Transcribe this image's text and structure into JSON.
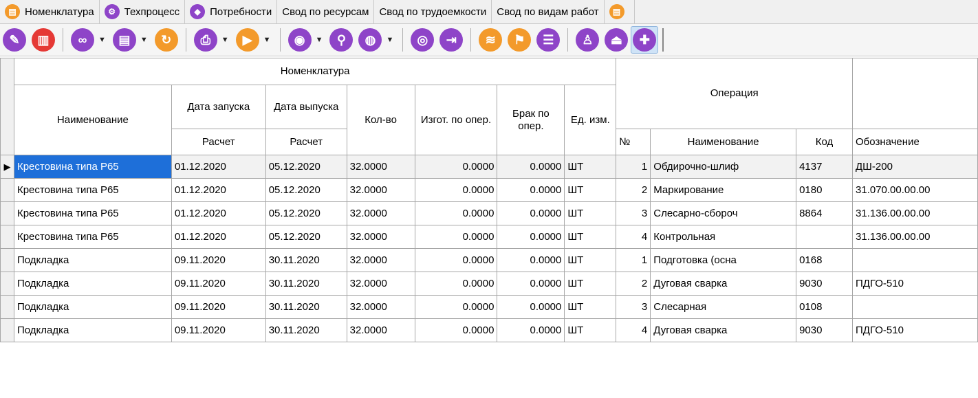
{
  "tabs": [
    {
      "label": "Номенклатура",
      "icon": "orange-book-icon"
    },
    {
      "label": "Техпроцесс",
      "icon": "purple-cog-icon"
    },
    {
      "label": "Потребности",
      "icon": "purple-tag-icon"
    },
    {
      "label": "Свод по ресурсам"
    },
    {
      "label": "Свод по трудоемкости"
    },
    {
      "label": "Свод по видам работ"
    }
  ],
  "toolbar": {
    "buttons": [
      "edit-icon",
      "delete-icon",
      "link-icon",
      "document-icon",
      "refresh-icon",
      "print-icon",
      "play-icon",
      "view-icon",
      "zoom-icon",
      "globe-icon",
      "disk-icon",
      "export-icon",
      "layers-icon",
      "flag-icon",
      "list-icon",
      "person-icon",
      "stamp-icon",
      "add-icon"
    ]
  },
  "grid": {
    "headers": {
      "group_nomenclature": "Номенклатура",
      "group_operation": "Операция",
      "name": "Наименование",
      "start_date": "Дата запуска",
      "release_date": "Дата выпуска",
      "calc1": "Расчет",
      "calc2": "Расчет",
      "qty": "Кол-во",
      "made": "Изгот. по опер.",
      "defect": "Брак по опер.",
      "unit": "Ед. изм.",
      "op_no": "№",
      "op_name": "Наименование",
      "op_code": "Код",
      "op_designation": "Обозначение"
    },
    "rows": [
      {
        "name": "Крестовина типа Р65",
        "start": "01.12.2020",
        "release": "05.12.2020",
        "qty": "32.0000",
        "made": "0.0000",
        "defect": "0.0000",
        "unit": "ШТ",
        "no": "1",
        "op": "Обдирочно-шлиф",
        "code": "4137",
        "des": "ДШ-200"
      },
      {
        "name": "Крестовина типа Р65",
        "start": "01.12.2020",
        "release": "05.12.2020",
        "qty": "32.0000",
        "made": "0.0000",
        "defect": "0.0000",
        "unit": "ШТ",
        "no": "2",
        "op": "Маркирование",
        "code": "0180",
        "des": "31.070.00.00.00"
      },
      {
        "name": "Крестовина типа Р65",
        "start": "01.12.2020",
        "release": "05.12.2020",
        "qty": "32.0000",
        "made": "0.0000",
        "defect": "0.0000",
        "unit": "ШТ",
        "no": "3",
        "op": "Слесарно-сбороч",
        "code": "8864",
        "des": "31.136.00.00.00"
      },
      {
        "name": "Крестовина типа Р65",
        "start": "01.12.2020",
        "release": "05.12.2020",
        "qty": "32.0000",
        "made": "0.0000",
        "defect": "0.0000",
        "unit": "ШТ",
        "no": "4",
        "op": "Контрольная",
        "code": "",
        "des": "31.136.00.00.00"
      },
      {
        "name": "Подкладка",
        "start": "09.11.2020",
        "release": "30.11.2020",
        "qty": "32.0000",
        "made": "0.0000",
        "defect": "0.0000",
        "unit": "ШТ",
        "no": "1",
        "op": "Подготовка (осна",
        "code": "0168",
        "des": ""
      },
      {
        "name": "Подкладка",
        "start": "09.11.2020",
        "release": "30.11.2020",
        "qty": "32.0000",
        "made": "0.0000",
        "defect": "0.0000",
        "unit": "ШТ",
        "no": "2",
        "op": "Дуговая сварка",
        "code": "9030",
        "des": "ПДГО-510"
      },
      {
        "name": "Подкладка",
        "start": "09.11.2020",
        "release": "30.11.2020",
        "qty": "32.0000",
        "made": "0.0000",
        "defect": "0.0000",
        "unit": "ШТ",
        "no": "3",
        "op": "Слесарная",
        "code": "0108",
        "des": ""
      },
      {
        "name": "Подкладка",
        "start": "09.11.2020",
        "release": "30.11.2020",
        "qty": "32.0000",
        "made": "0.0000",
        "defect": "0.0000",
        "unit": "ШТ",
        "no": "4",
        "op": "Дуговая сварка",
        "code": "9030",
        "des": "ПДГО-510"
      }
    ]
  },
  "colors": {
    "selection": "#1e6fd9",
    "purple": "#8e44c8",
    "orange": "#f39a2b",
    "red": "#e53935"
  }
}
